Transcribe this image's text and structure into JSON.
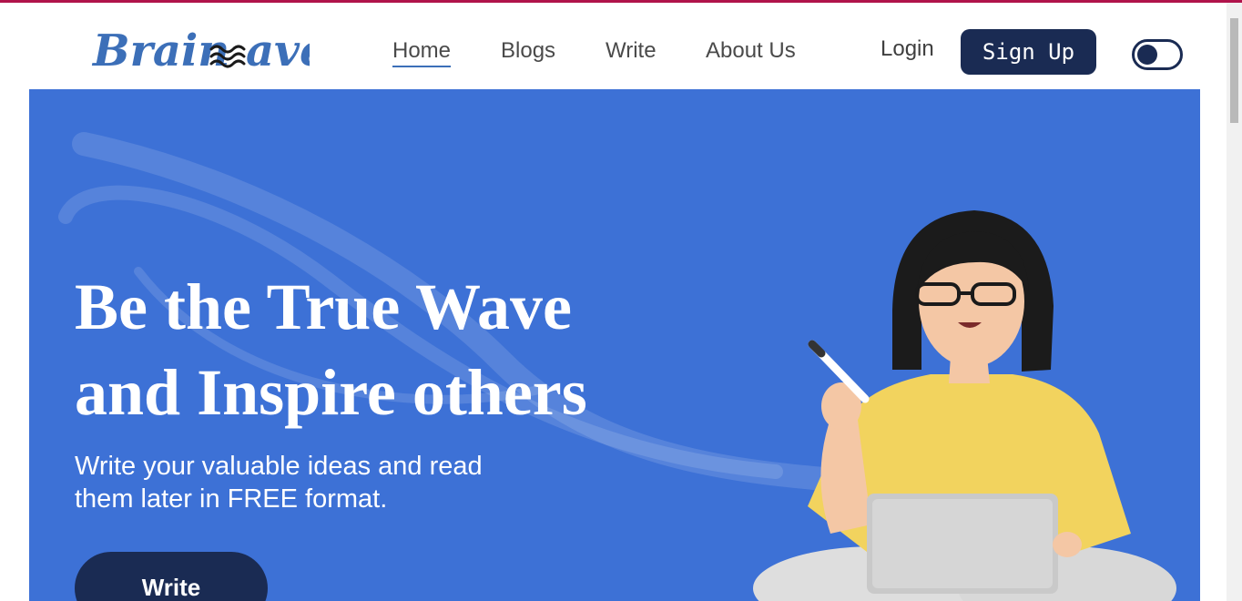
{
  "brand": {
    "name_part1": "Brain",
    "name_part2": "ave",
    "wave_symbol": "≋"
  },
  "nav": {
    "items": [
      {
        "label": "Home",
        "active": true
      },
      {
        "label": "Blogs",
        "active": false
      },
      {
        "label": "Write",
        "active": false
      },
      {
        "label": "About Us",
        "active": false
      }
    ]
  },
  "auth": {
    "login_label": "Login",
    "signup_label": "Sign Up"
  },
  "theme_toggle": {
    "state": "off"
  },
  "hero": {
    "title_line1": "Be the True Wave",
    "title_line2": "and Inspire others",
    "subtitle_line1": "Write your valuable ideas and read",
    "subtitle_line2": "them later in FREE format.",
    "cta_label": "Write"
  },
  "colors": {
    "accent_top_line": "#b0134b",
    "brand_blue": "#3c6fb8",
    "hero_background": "#3d71d6",
    "dark_navy": "#1a2b53",
    "shirt_yellow": "#f2d35e"
  },
  "icons": [
    "wave-logo-icon",
    "theme-toggle-icon",
    "pen-icon",
    "laptop-icon"
  ]
}
